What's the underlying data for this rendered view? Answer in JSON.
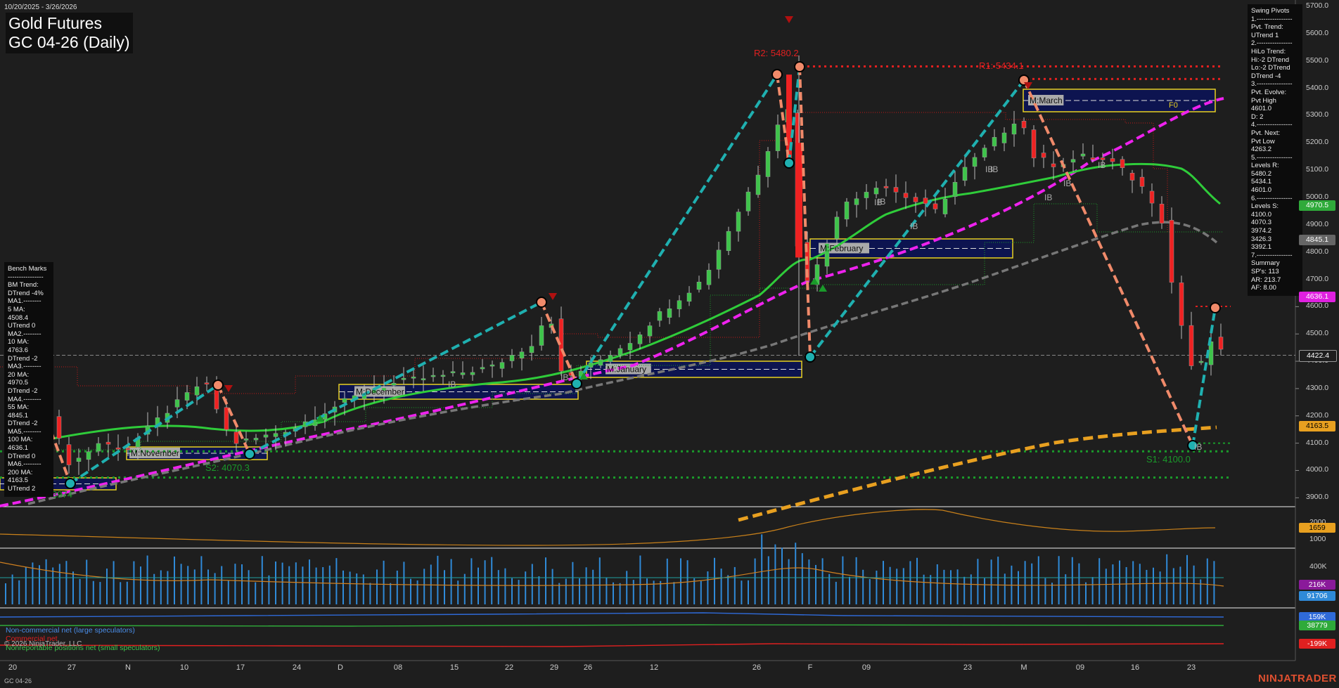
{
  "header": {
    "date_range": "10/20/2025 - 3/26/2026",
    "title_line1": "Gold Futures",
    "title_line2": "GC 04-26 (Daily)"
  },
  "swing_pivots_panel": "Swing Pivots\n1.----------------\nPvt. Trend:\nUTrend 1\n2.----------------\nHiLo Trend:\nHi:-2 DTrend\nLo:-2 DTrend\nDTrend -4\n3.----------------\nPvt. Evolve:\nPvt High\n4601.0\nD: 2\n4.----------------\nPvt. Next:\nPvt Low\n4263.2\n5.----------------\nLevels R:\n5480.2\n5434.1\n4601.0\n6.----------------\nLevels S:\n4100.0\n4070.3\n3974.2\n3426.3\n3392.1\n7.----------------\nSummary\nSP's: 113\nAR: 213.7\nAF: 8.00",
  "bench_marks_panel": "Bench Marks\n----------------\nBM Trend:\nDTrend -4%\nMA1.--------\n5 MA:\n4508.4\nUTrend 0\nMA2.--------\n10 MA:\n4763.6\nDTrend -2\nMA3.--------\n20 MA:\n4970.5\nDTrend -2\nMA4.--------\n55 MA:\n4845.1\nDTrend -2\nMA5.--------\n100 MA:\n4636.1\nDTrend 0\nMA6.--------\n200 MA:\n4163.5\nUTrend 2",
  "price_axis": [
    "5700.0",
    "5600.0",
    "5500.0",
    "5400.0",
    "5300.0",
    "5200.0",
    "5100.0",
    "5000.0",
    "4900.0",
    "4800.0",
    "4700.0",
    "4600.0",
    "4500.0",
    "4400.0",
    "4300.0",
    "4200.0",
    "4100.0",
    "4000.0",
    "3900.0"
  ],
  "price_tags": [
    {
      "text": "4970.5",
      "bg": "#2faa3a",
      "fg": "#ffffff",
      "price": 4970.5
    },
    {
      "text": "4845.1",
      "bg": "#666666",
      "fg": "#ffffff",
      "price": 4845.1
    },
    {
      "text": "4636.1",
      "bg": "#e020e0",
      "fg": "#ffffff",
      "price": 4636.1
    },
    {
      "text": "4422.4",
      "bg": "#1e1e1e",
      "fg": "#ffffff",
      "price": 4422.4
    },
    {
      "text": "4163.5",
      "bg": "#e8a020",
      "fg": "#000000",
      "price": 4163.5
    }
  ],
  "indicator_axis": {
    "p1_labels": [
      "2000",
      "1000"
    ],
    "p1_tag": {
      "text": "1659",
      "bg": "#e8a020",
      "fg": "#000000"
    },
    "p2_labels": [
      "400K"
    ],
    "p2_tags": [
      {
        "text": "216K",
        "bg": "#8a1a9a",
        "fg": "#ffffff"
      },
      {
        "text": "91706",
        "bg": "#2f8ad8",
        "fg": "#ffffff"
      }
    ],
    "p3_tags": [
      {
        "text": "159K",
        "bg": "#2f6ad8",
        "fg": "#ffffff"
      },
      {
        "text": "38779",
        "bg": "#2faa3a",
        "fg": "#ffffff"
      },
      {
        "text": "-199K",
        "bg": "#e02020",
        "fg": "#ffffff"
      }
    ]
  },
  "chart_labels": {
    "r2": "R2: 5480.2",
    "r1": "R1: 5434.1",
    "s1": "S1: 4100.0",
    "s2": "S2: 4070.3",
    "s3": "3974",
    "f0": "F0",
    "months": [
      "M:November",
      "M:December",
      "M:January",
      "M:February",
      "M:March"
    ],
    "ib": "IB"
  },
  "x_axis": [
    "20",
    "27",
    "N",
    "10",
    "17",
    "24",
    "D",
    "08",
    "15",
    "22",
    "29",
    "26",
    "12",
    "26",
    "F",
    "09",
    "23",
    "M",
    "09",
    "16",
    "23"
  ],
  "legend": {
    "non_commercial": "Non-commercial net (large speculators)",
    "commercial": "Commercial net",
    "nonreportable": "Nonreportable positions net (small speculators)",
    "copyright": "© 2026 NinjaTrader, LLC"
  },
  "footer": "GC 04-26",
  "watermark": "NINJATRADER",
  "colors": {
    "ma20": "#2fcc3a",
    "ma55": "#777777",
    "ma100": "#ee22ee",
    "ma200": "#e8a020",
    "up_candle": "#3ec44a",
    "down_candle": "#ee2222",
    "swing_up": "#1fb0b0",
    "swing_down": "#f08a6a"
  },
  "chart_data": {
    "type": "candlestick",
    "symbol": "GC 04-26",
    "timeframe": "Daily",
    "ylim": [
      3850,
      5750
    ],
    "close_last": 4422.4,
    "resistance_levels": [
      5480.2,
      5434.1,
      4601.0
    ],
    "support_levels": [
      4100.0,
      4070.3,
      3974.2,
      3426.3,
      3392.1
    ],
    "moving_averages": {
      "ma5": 4508.4,
      "ma10": 4763.6,
      "ma20": 4970.5,
      "ma55": 4845.1,
      "ma100": 4636.1,
      "ma200": 4163.5
    },
    "swing_pivots_approx": [
      {
        "t": "Oct 27",
        "price": 3974
      },
      {
        "t": "Nov 13",
        "price": 4330
      },
      {
        "t": "Nov 18",
        "price": 4070
      },
      {
        "t": "Dec 26",
        "price": 4600
      },
      {
        "t": "Dec 31",
        "price": 4330
      },
      {
        "t": "Jan 28",
        "price": 5440
      },
      {
        "t": "Jan 29",
        "price": 5130
      },
      {
        "t": "Jan 30",
        "price": 5480
      },
      {
        "t": "Feb 2",
        "price": 4420
      },
      {
        "t": "Mar 2",
        "price": 5420
      },
      {
        "t": "Mar 23",
        "price": 4100
      },
      {
        "t": "Mar 25",
        "price": 4601
      }
    ]
  }
}
